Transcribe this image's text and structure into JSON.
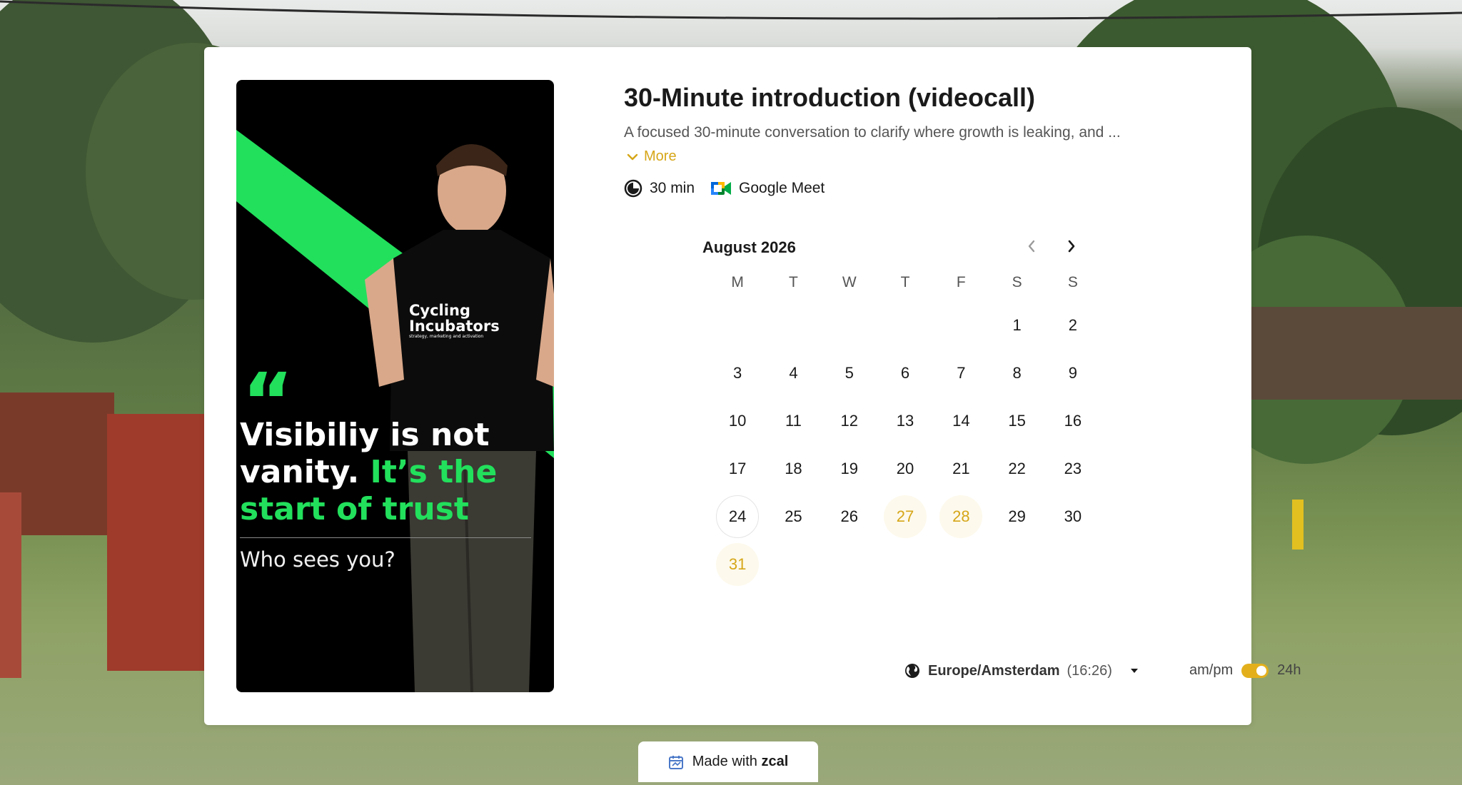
{
  "promo": {
    "quote_glyph": "“",
    "quote_line1": "Visibiliy is not",
    "quote_line2a": "vanity.",
    "quote_line2b": "It’s the",
    "quote_line3": "start of trust",
    "subline": "Who sees you?",
    "shirt_logo_line1": "Cycling",
    "shirt_logo_line2": "Incubators",
    "shirt_logo_tagline": "strategy, marketing and activation",
    "accent_color": "#22e05c"
  },
  "event": {
    "title": "30-Minute introduction (videocall)",
    "description": "A focused 30-minute conversation to clarify where growth is leaking, and ...",
    "more_label": "More",
    "duration": "30 min",
    "duration_icon": "clock-icon",
    "location": "Google Meet",
    "location_icon": "google-meet-icon"
  },
  "calendar": {
    "month_label": "August 2026",
    "weekdays": [
      "M",
      "T",
      "W",
      "T",
      "F",
      "S",
      "S"
    ],
    "leading_blanks": 5,
    "days": [
      1,
      2,
      3,
      4,
      5,
      6,
      7,
      8,
      9,
      10,
      11,
      12,
      13,
      14,
      15,
      16,
      17,
      18,
      19,
      20,
      21,
      22,
      23,
      24,
      25,
      26,
      27,
      28,
      29,
      30,
      31
    ],
    "today": 24,
    "available_days": [
      27,
      28,
      31
    ],
    "accent_color": "#d6a618"
  },
  "timezone": {
    "zone": "Europe/Amsterdam",
    "current_time": "(16:26)",
    "icon": "globe-icon"
  },
  "time_format": {
    "left_label": "am/pm",
    "right_label": "24h",
    "selected": "24h"
  },
  "footer": {
    "made_with": "Made with",
    "brand": "zcal",
    "icon": "zcal-calendar-icon"
  }
}
